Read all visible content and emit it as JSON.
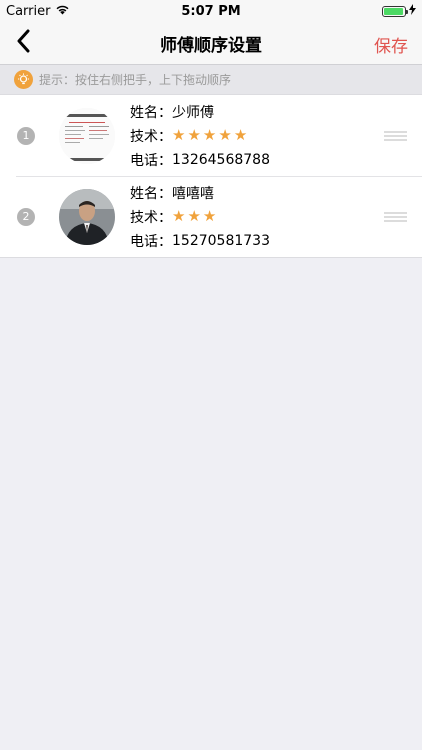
{
  "status_bar": {
    "carrier": "Carrier",
    "time": "5:07 PM",
    "battery_level": 0.95
  },
  "nav": {
    "title": "师傅顺序设置",
    "save_label": "保存"
  },
  "tip": {
    "text": "提示：按住右侧把手，上下拖动顺序"
  },
  "list": {
    "items": [
      {
        "index": "1",
        "name_label": "姓名：",
        "name": "少师傅",
        "skill_label": "技术：",
        "stars": 5,
        "phone_label": "电话：",
        "phone": "13264568788",
        "avatar": "document-thumbnail"
      },
      {
        "index": "2",
        "name_label": "姓名：",
        "name": "嘻嘻嘻",
        "skill_label": "技术：",
        "stars": 3,
        "phone_label": "电话：",
        "phone": "15270581733",
        "avatar": "man-in-suit-photo"
      }
    ]
  },
  "colors": {
    "accent": "#e0544f",
    "star": "#f0a23c",
    "background": "#efeff4"
  },
  "icons": {
    "back": "chevron-left-icon",
    "tip": "lightbulb-icon",
    "drag": "drag-handle-icon",
    "wifi": "wifi-icon"
  }
}
